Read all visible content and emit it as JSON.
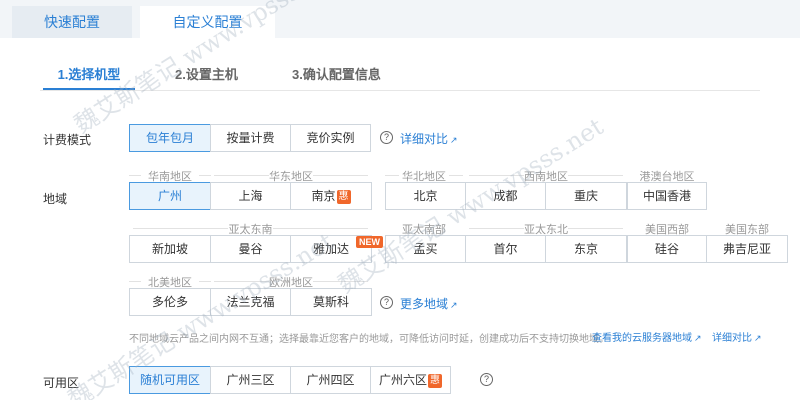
{
  "top_tabs": {
    "quick": "快速配置",
    "custom": "自定义配置"
  },
  "steps": [
    "1.选择机型",
    "2.设置主机",
    "3.确认配置信息"
  ],
  "billing": {
    "label": "计费模式",
    "options": [
      "包年包月",
      "按量计费",
      "竞价实例"
    ],
    "selected": "包年包月",
    "compare_link": "详细对比"
  },
  "region": {
    "label": "地域",
    "groups_row1": [
      "华南地区",
      "华东地区",
      "华北地区",
      "西南地区",
      "港澳台地区"
    ],
    "groups_row2": [
      "亚太东南",
      "亚太南部",
      "亚太东北",
      "美国西部",
      "美国东部"
    ],
    "groups_row3": [
      "北美地区",
      "欧洲地区"
    ],
    "row1": [
      "广州",
      "上海",
      "南京",
      "北京",
      "成都",
      "重庆",
      "中国香港"
    ],
    "row2": [
      "新加坡",
      "曼谷",
      "雅加达",
      "孟买",
      "首尔",
      "东京",
      "硅谷",
      "弗吉尼亚"
    ],
    "row3": [
      "多伦多",
      "法兰克福",
      "莫斯科"
    ],
    "selected": "广州",
    "discount_badge": "惠",
    "new_badge": "NEW",
    "more_link": "更多地域",
    "note": "不同地域云产品之间内网不互通；选择最靠近您客户的地域，可降低访问时延，创建成功后不支持切换地域。",
    "my_servers_link": "查看我的云服务器地域",
    "compare_link": "详细对比"
  },
  "zone": {
    "label": "可用区",
    "options": [
      "随机可用区",
      "广州三区",
      "广州四区",
      "广州六区"
    ],
    "selected": "随机可用区",
    "discount_badge": "惠"
  },
  "watermark_text": [
    "魏艾斯笔记 www.vpsss.net",
    "魏艾斯笔记 www.vpsss.net",
    "魏艾斯笔记 www.vpsss.net"
  ],
  "icons": {
    "help": "question-circle-icon",
    "external": "external-link-icon"
  },
  "colors": {
    "accent": "#2a7fd4",
    "selected_bg": "#e8f3fc",
    "badge": "#f0672b"
  }
}
